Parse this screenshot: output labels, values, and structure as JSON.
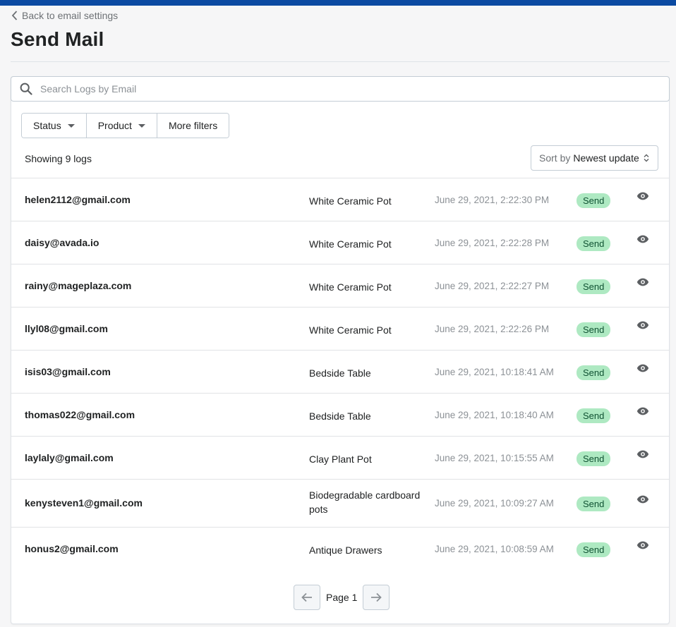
{
  "header": {
    "back_label": "Back to email settings",
    "title": "Send Mail"
  },
  "search": {
    "placeholder": "Search Logs by Email",
    "value": ""
  },
  "filters": [
    {
      "label": "Status",
      "has_caret": true
    },
    {
      "label": "Product",
      "has_caret": true
    },
    {
      "label": "More filters",
      "has_caret": false
    }
  ],
  "summary": {
    "showing": "Showing 9 logs"
  },
  "sort": {
    "prefix": "Sort by",
    "value": "Newest update"
  },
  "logs": [
    {
      "email": "helen2112@gmail.com",
      "product": "White Ceramic Pot",
      "date": "June 29, 2021, 2:22:30 PM",
      "status": "Send"
    },
    {
      "email": "daisy@avada.io",
      "product": "White Ceramic Pot",
      "date": "June 29, 2021, 2:22:28 PM",
      "status": "Send"
    },
    {
      "email": "rainy@mageplaza.com",
      "product": "White Ceramic Pot",
      "date": "June 29, 2021, 2:22:27 PM",
      "status": "Send"
    },
    {
      "email": "llyl08@gmail.com",
      "product": "White Ceramic Pot",
      "date": "June 29, 2021, 2:22:26 PM",
      "status": "Send"
    },
    {
      "email": "isis03@gmail.com",
      "product": "Bedside Table",
      "date": "June 29, 2021, 10:18:41 AM",
      "status": "Send"
    },
    {
      "email": "thomas022@gmail.com",
      "product": "Bedside Table",
      "date": "June 29, 2021, 10:18:40 AM",
      "status": "Send"
    },
    {
      "email": "laylaly@gmail.com",
      "product": "Clay Plant Pot",
      "date": "June 29, 2021, 10:15:55 AM",
      "status": "Send"
    },
    {
      "email": "kenysteven1@gmail.com",
      "product": "Biodegradable cardboard pots",
      "date": "June 29, 2021, 10:09:27 AM",
      "status": "Send"
    },
    {
      "email": "honus2@gmail.com",
      "product": "Antique Drawers",
      "date": "June 29, 2021, 10:08:59 AM",
      "status": "Send"
    }
  ],
  "pagination": {
    "label": "Page 1"
  },
  "colors": {
    "topbar": "#0b4aa2",
    "badge_bg": "#aee9c2",
    "badge_text": "#0f5132"
  },
  "icons": {
    "back": "chevron-left-icon",
    "search": "search-icon",
    "view": "eye-icon",
    "prev": "arrow-left-icon",
    "next": "arrow-right-icon",
    "sort": "sort-updown-icon",
    "dropdown": "caret-down-icon"
  }
}
